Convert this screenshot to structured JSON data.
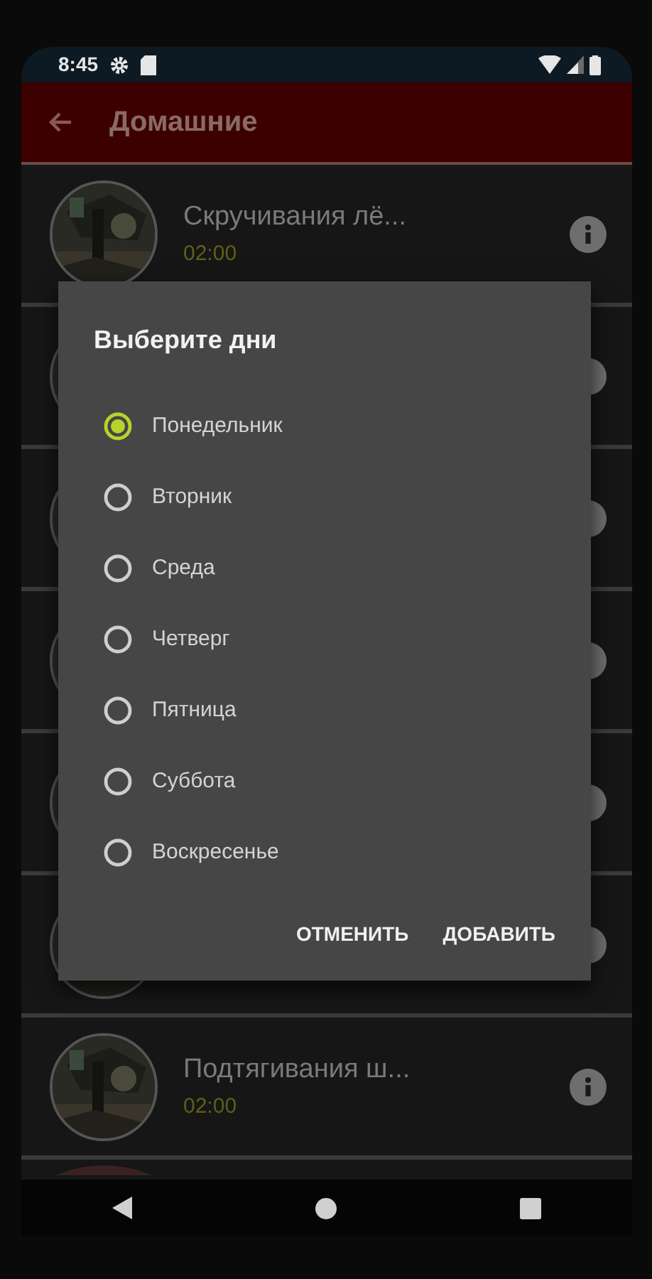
{
  "status_bar": {
    "time": "8:45"
  },
  "app_bar": {
    "title": "Домашние"
  },
  "list": [
    {
      "kind": "exercise",
      "title": "Скручивания лё...",
      "duration": "02:00"
    },
    {
      "kind": "covered"
    },
    {
      "kind": "covered"
    },
    {
      "kind": "covered"
    },
    {
      "kind": "covered"
    },
    {
      "kind": "covered"
    },
    {
      "kind": "exercise",
      "title": "Подтягивания ш...",
      "duration": "02:00"
    },
    {
      "kind": "cut"
    }
  ],
  "dialog": {
    "title": "Выберите дни",
    "options": [
      {
        "label": "Понедельник",
        "selected": true
      },
      {
        "label": "Вторник",
        "selected": false
      },
      {
        "label": "Среда",
        "selected": false
      },
      {
        "label": "Четверг",
        "selected": false
      },
      {
        "label": "Пятница",
        "selected": false
      },
      {
        "label": "Суббота",
        "selected": false
      },
      {
        "label": "Воскресенье",
        "selected": false
      }
    ],
    "buttons": [
      "ОТМЕНИТЬ",
      "ДОБАВИТЬ"
    ]
  }
}
